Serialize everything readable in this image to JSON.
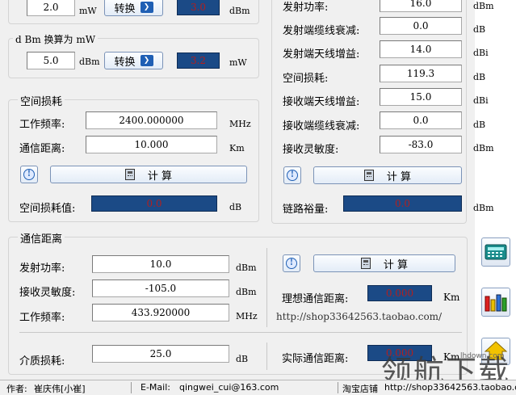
{
  "top_left": {
    "row1": {
      "input": "2.0",
      "unit_in": "mW",
      "button": "转换",
      "result": "3.0",
      "unit_out": "dBm"
    },
    "group_dbm": {
      "title": "d Bm 换算为 mW",
      "input": "5.0",
      "unit_in": "dBm",
      "button": "转换",
      "result": "3.2",
      "unit_out": "mW"
    }
  },
  "space_loss": {
    "title": "空间损耗",
    "freq_label": "工作频率:",
    "freq_value": "2400.000000",
    "freq_unit": "MHz",
    "dist_label": "通信距离:",
    "dist_value": "10.000",
    "dist_unit": "Km",
    "calc_button": "计 算",
    "result_label": "空间损耗值:",
    "result_value": "0.0",
    "result_unit": "dB"
  },
  "link_budget": {
    "rows": [
      {
        "label": "发射功率:",
        "value": "16.0",
        "unit": "dBm"
      },
      {
        "label": "发射端缆线衰减:",
        "value": "0.0",
        "unit": "dB"
      },
      {
        "label": "发射端天线增益:",
        "value": "14.0",
        "unit": "dBi"
      },
      {
        "label": "空间损耗:",
        "value": "119.3",
        "unit": "dB"
      },
      {
        "label": "接收端天线增益:",
        "value": "15.0",
        "unit": "dBi"
      },
      {
        "label": "接收端缆线衰减:",
        "value": "0.0",
        "unit": "dB"
      },
      {
        "label": "接收灵敏度:",
        "value": "-83.0",
        "unit": "dBm"
      }
    ],
    "calc_button": "计 算",
    "margin_label": "链路裕量:",
    "margin_value": "0.0",
    "margin_unit": "dBm"
  },
  "comm_distance": {
    "title": "通信距离",
    "power_label": "发射功率:",
    "power_value": "10.0",
    "power_unit": "dBm",
    "sens_label": "接收灵敏度:",
    "sens_value": "-105.0",
    "sens_unit": "dBm",
    "freq_label": "工作频率:",
    "freq_value": "433.920000",
    "freq_unit": "MHz",
    "medium_label": "介质损耗:",
    "medium_value": "25.0",
    "medium_unit": "dB",
    "calc_button": "计 算",
    "ideal_label": "理想通信距离:",
    "ideal_value": "0.000",
    "ideal_unit": "Km",
    "url": "http://shop33642563.taobao.com/",
    "actual_label": "实际通信距离:",
    "actual_value": "0.000",
    "actual_unit": "Km"
  },
  "status_bar": {
    "author_label": "作者:",
    "author_name": "崔庆伟[小崔]",
    "email_label": "E-Mail:",
    "email": "qingwei_cui@163.com",
    "shop_label": "淘宝店铺",
    "shop_url": "http://shop33642563.taobao.com/"
  },
  "watermark": {
    "text": "领航下载",
    "site": "lhdown.com"
  },
  "colors": {
    "result_bg": "#1b4a86",
    "result_text": "#b02020",
    "panel_bg": "#f0f0f0"
  }
}
